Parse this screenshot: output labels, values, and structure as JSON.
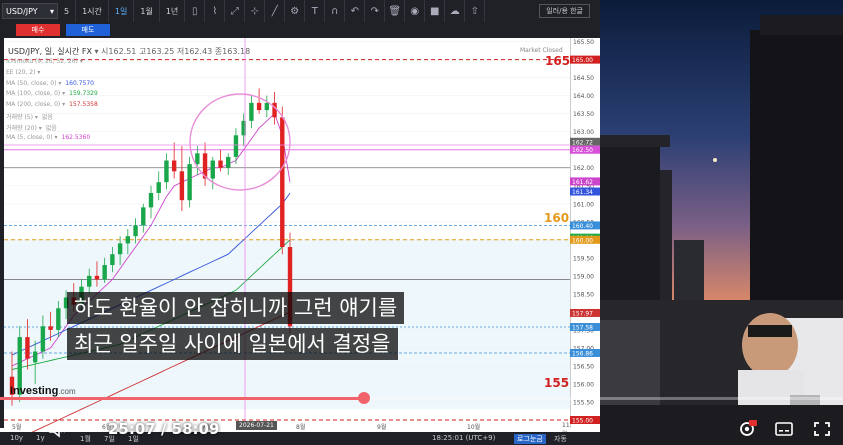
{
  "toolbar": {
    "symbol": "USD/JPY",
    "symbol_caret": "5",
    "timeframes": [
      "1시간",
      "1일",
      "1월",
      "1년"
    ],
    "active_timeframe": "1일",
    "lang_button": "일러/용 한글"
  },
  "trade": {
    "sell": "매수",
    "buy": "매도"
  },
  "quote": {
    "title": "USD/JPY, 일, 실시간 FX",
    "open_label": "시",
    "open": "162.51",
    "high_label": "고",
    "high": "163.25",
    "low_label": "저",
    "low": "162.43",
    "close_label": "종",
    "close": "163.18",
    "market_status": "Market Closed"
  },
  "indicators": [
    {
      "label": "Ichimoku (9, 26, 52, 26)",
      "value": "",
      "color": "#999999"
    },
    {
      "label": "EE (20, 2)",
      "value": "",
      "color": "#999999"
    },
    {
      "label": "MA (50, close, 0)",
      "value": "160.7570",
      "color": "#3355dd"
    },
    {
      "label": "MA (100, close, 0)",
      "value": "159.7329",
      "color": "#22aa44"
    },
    {
      "label": "MA (200, close, 0)",
      "value": "157.5358",
      "color": "#cc3333"
    },
    {
      "label": "거래량 (5)",
      "value": "없음",
      "color": "#999999"
    },
    {
      "label": "거래량 (20)",
      "value": "없음",
      "color": "#999999"
    },
    {
      "label": "MA (5, close, 0)",
      "value": "162.5360",
      "color": "#cc44cc"
    }
  ],
  "chart_data": {
    "type": "candlestick",
    "symbol": "USD/JPY",
    "timeframe": "일",
    "ylim": [
      155.0,
      165.6
    ],
    "y_ticks": [
      "165.50",
      "165.00",
      "164.50",
      "164.00",
      "163.50",
      "163.00",
      "162.50",
      "162.00",
      "161.50",
      "161.00",
      "160.50",
      "160.00",
      "159.50",
      "159.00",
      "158.50",
      "158.00",
      "157.50",
      "157.00",
      "156.50",
      "156.00",
      "155.50",
      "155.00"
    ],
    "x_ticks": [
      "5월",
      "6월",
      "7월",
      "8월",
      "9월",
      "10월",
      "11월"
    ],
    "cursor_date": "2026-07-21",
    "price_tags": [
      {
        "label": "165.00",
        "value": 165.0,
        "color": "#d12020"
      },
      {
        "label": "162.72",
        "value": 162.72,
        "color": "#666666"
      },
      {
        "label": "162.50",
        "value": 162.5,
        "color": "#d84fd8"
      },
      {
        "label": "161.62",
        "value": 161.62,
        "color": "#cc44cc"
      },
      {
        "label": "161.34",
        "value": 161.34,
        "color": "#3355dd"
      },
      {
        "label": "160.40",
        "value": 160.4,
        "color": "#3a8fd8"
      },
      {
        "label": "160.06",
        "value": 160.06,
        "color": "#22aa44"
      },
      {
        "label": "160.00",
        "value": 160.0,
        "color": "#e39a1a"
      },
      {
        "label": "157.97",
        "value": 157.97,
        "color": "#cc3333"
      },
      {
        "label": "157.58",
        "value": 157.58,
        "color": "#3a8fd8"
      },
      {
        "label": "156.86",
        "value": 156.86,
        "color": "#3a8fd8"
      },
      {
        "label": "155.00",
        "value": 155.0,
        "color": "#d12020"
      }
    ],
    "key_levels": [
      {
        "label": "165",
        "value": 165.0,
        "color": "#d12020"
      },
      {
        "label": "160",
        "value": 160.0,
        "color": "#e39a1a"
      },
      {
        "label": "155",
        "value": 155.0,
        "color": "#d12020"
      }
    ],
    "candles": [
      [
        156.2,
        156.9,
        155.4,
        155.7
      ],
      [
        155.7,
        157.6,
        155.5,
        157.3
      ],
      [
        157.3,
        157.8,
        156.4,
        156.7
      ],
      [
        156.6,
        157.2,
        156.0,
        156.9
      ],
      [
        156.9,
        157.9,
        156.7,
        157.6
      ],
      [
        157.6,
        158.0,
        157.2,
        157.5
      ],
      [
        157.5,
        158.3,
        157.3,
        158.1
      ],
      [
        158.1,
        158.6,
        157.8,
        158.4
      ],
      [
        158.4,
        158.8,
        158.0,
        158.2
      ],
      [
        158.2,
        158.9,
        158.0,
        158.7
      ],
      [
        158.7,
        159.2,
        158.5,
        159.0
      ],
      [
        159.0,
        159.4,
        158.7,
        158.9
      ],
      [
        158.9,
        159.5,
        158.8,
        159.3
      ],
      [
        159.3,
        159.8,
        159.1,
        159.6
      ],
      [
        159.6,
        160.1,
        159.3,
        159.9
      ],
      [
        159.9,
        160.3,
        159.6,
        160.1
      ],
      [
        160.1,
        160.6,
        159.9,
        160.4
      ],
      [
        160.4,
        161.0,
        160.2,
        160.9
      ],
      [
        160.9,
        161.5,
        160.6,
        161.3
      ],
      [
        161.3,
        161.9,
        161.1,
        161.6
      ],
      [
        161.6,
        162.4,
        161.4,
        162.2
      ],
      [
        162.2,
        162.7,
        161.7,
        161.9
      ],
      [
        161.9,
        162.6,
        160.8,
        161.1
      ],
      [
        161.1,
        162.3,
        160.9,
        162.1
      ],
      [
        162.1,
        162.6,
        161.8,
        162.4
      ],
      [
        162.4,
        162.7,
        161.5,
        161.7
      ],
      [
        161.7,
        162.3,
        161.4,
        162.2
      ],
      [
        162.2,
        162.5,
        161.9,
        162.0
      ],
      [
        162.0,
        162.4,
        161.8,
        162.3
      ],
      [
        162.3,
        163.1,
        162.1,
        162.9
      ],
      [
        162.9,
        163.5,
        162.6,
        163.3
      ],
      [
        163.3,
        164.0,
        163.1,
        163.8
      ],
      [
        163.8,
        164.2,
        163.5,
        163.6
      ],
      [
        163.6,
        164.0,
        163.4,
        163.8
      ],
      [
        163.8,
        164.1,
        163.2,
        163.4
      ],
      [
        163.4,
        163.7,
        159.6,
        159.8
      ],
      [
        159.8,
        160.2,
        157.4,
        157.6
      ]
    ],
    "ma_series": [
      {
        "label": "MA5",
        "color": "#cc44cc",
        "values": [
          156.5,
          156.6,
          156.7,
          156.8,
          156.9,
          157.0,
          157.3,
          157.6,
          157.9,
          158.1,
          158.3,
          158.5,
          158.7,
          158.9,
          159.2,
          159.5,
          159.8,
          160.1,
          160.4,
          160.8,
          161.2,
          161.5,
          161.6,
          161.7,
          161.8,
          161.9,
          162.0,
          162.0,
          162.1,
          162.2,
          162.5,
          162.8,
          163.1,
          163.3,
          163.5,
          162.9,
          161.6
        ]
      },
      {
        "label": "MA50",
        "color": "#3355dd",
        "values": [
          156.8,
          156.9,
          157.0,
          157.1,
          157.2,
          157.3,
          157.4,
          157.5,
          157.6,
          157.7,
          157.8,
          157.9,
          158.0,
          158.1,
          158.2,
          158.3,
          158.4,
          158.5,
          158.6,
          158.7,
          158.8,
          158.9,
          159.0,
          159.1,
          159.2,
          159.3,
          159.4,
          159.5,
          159.6,
          159.8,
          160.0,
          160.2,
          160.4,
          160.6,
          160.8,
          161.0,
          161.3
        ]
      },
      {
        "label": "MA100",
        "color": "#22aa44",
        "values": [
          156.4,
          156.45,
          156.5,
          156.55,
          156.6,
          156.65,
          156.7,
          156.75,
          156.8,
          156.85,
          156.9,
          156.95,
          157.0,
          157.05,
          157.1,
          157.2,
          157.3,
          157.4,
          157.5,
          157.6,
          157.7,
          157.8,
          157.9,
          158.0,
          158.1,
          158.2,
          158.3,
          158.4,
          158.5,
          158.6,
          158.8,
          159.0,
          159.2,
          159.4,
          159.6,
          159.8,
          160.0
        ]
      },
      {
        "label": "MA200",
        "color": "#cc3333",
        "values": [
          154.4,
          154.5,
          154.6,
          154.7,
          154.8,
          154.9,
          155.0,
          155.1,
          155.2,
          155.3,
          155.4,
          155.5,
          155.6,
          155.7,
          155.8,
          155.9,
          156.0,
          156.1,
          156.2,
          156.3,
          156.4,
          156.5,
          156.6,
          156.7,
          156.8,
          156.9,
          157.0,
          157.1,
          157.2,
          157.3,
          157.4,
          157.5,
          157.6,
          157.7,
          157.8,
          157.9,
          158.0
        ]
      }
    ]
  },
  "logo": {
    "main": "Investing",
    "suffix": ".com"
  },
  "status": {
    "left": [
      "10y",
      "1y",
      "1월",
      "7일",
      "1일"
    ],
    "clock": "18:25:01 (UTC+9)",
    "log_label": "로그눈금",
    "auto_label": "자동"
  },
  "video": {
    "time": "25:07 / 58:09",
    "progress": 0.432,
    "accent": "#f2626b",
    "subtitles": [
      "하도 환율이 안 잡히니까 그런 얘기를",
      "최근 일주일 사이에 일본에서 결정을"
    ],
    "icons": [
      "mute-icon",
      "settings-icon",
      "subtitles-icon",
      "fullscreen-icon"
    ]
  }
}
